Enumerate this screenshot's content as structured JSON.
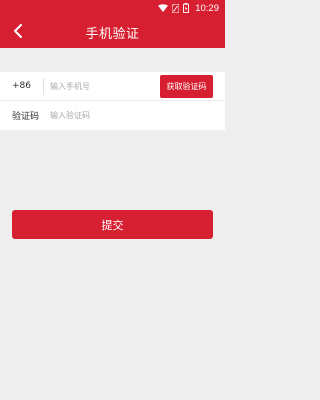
{
  "status_bar": {
    "time": "10:29",
    "icons": [
      "wifi-icon",
      "sim-icon",
      "battery-icon"
    ]
  },
  "header": {
    "title": "手机验证",
    "back_icon": "back-arrow-icon"
  },
  "form": {
    "phone_prefix": "+86",
    "phone_placeholder": "输入手机号",
    "get_code_label": "获取验证码",
    "code_label": "验证码",
    "code_placeholder": "输入验证码"
  },
  "actions": {
    "submit_label": "提交"
  },
  "colors": {
    "accent": "#d61f30",
    "background": "#eeeeee",
    "surface": "#ffffff"
  }
}
